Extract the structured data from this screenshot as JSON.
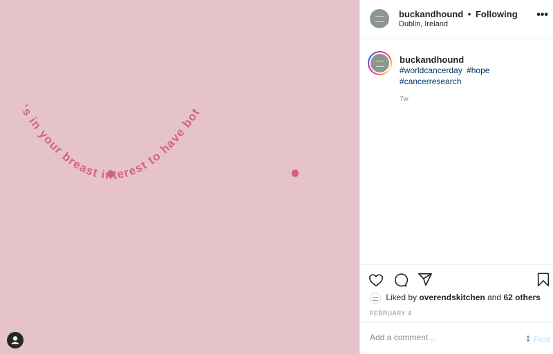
{
  "post": {
    "image_text": "It's in your breast interest to have both!",
    "colors": {
      "background": "#e6c3ca",
      "text": "#d0667f",
      "dots": "#d4607d"
    }
  },
  "header": {
    "username": "buckandhound",
    "separator": "•",
    "follow_status": "Following",
    "location": "Dublin, Ireland",
    "more_icon": "more-horizontal-icon",
    "more_label": "•••"
  },
  "caption": {
    "username": "buckandhound",
    "hashtags": [
      "#worldcancerday",
      "#hope",
      "#cancerresearch"
    ],
    "time": "7w"
  },
  "actions": {
    "icons": [
      "heart-icon",
      "comment-icon",
      "share-icon",
      "bookmark-icon"
    ]
  },
  "likes": {
    "prefix": "Liked by",
    "liker": "overendskitchen",
    "conjunction": "and",
    "others": "62 others"
  },
  "date": "FEBRUARY 4",
  "add_comment": {
    "placeholder": "Add a comment...",
    "post_label": "Post"
  }
}
